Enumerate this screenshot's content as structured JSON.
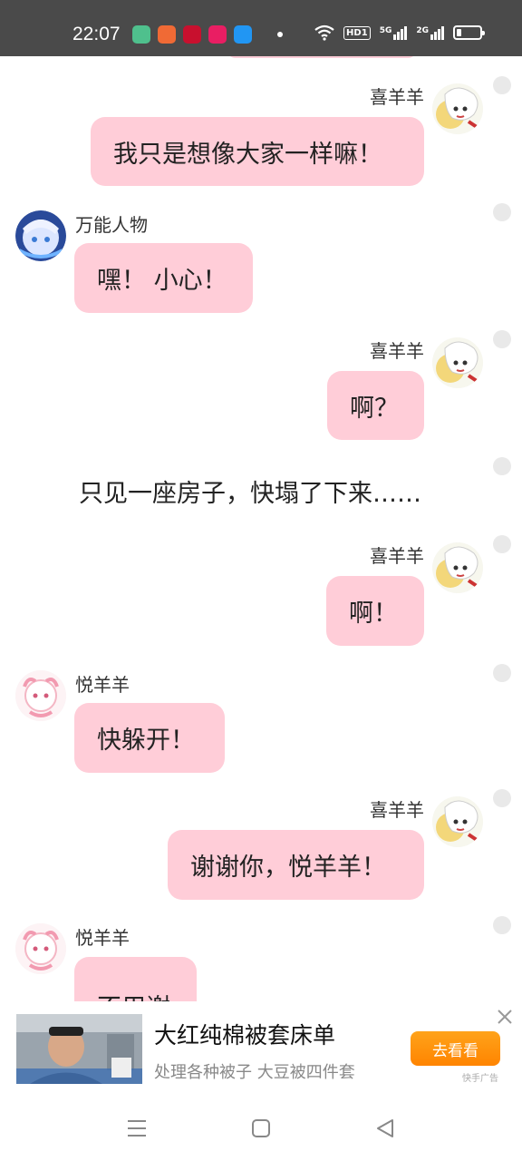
{
  "status_bar": {
    "time": "22:07",
    "app_icon_colors": [
      "#4fc08d",
      "#f06a35",
      "#c8102e",
      "#e91e63",
      "#2196f3"
    ],
    "network_labels": [
      "HD1",
      "5G",
      "2G"
    ],
    "battery_level": 0.2
  },
  "chat": {
    "messages": [
      {
        "type": "message",
        "side": "right",
        "sender": "喜羊羊",
        "text": "我只是想像大家一样嘛！",
        "avatar": "xiyangyang-avatar"
      },
      {
        "type": "message",
        "side": "left",
        "sender": "万能人物",
        "text": "嘿！ 小心！",
        "avatar": "wanneng-avatar"
      },
      {
        "type": "message",
        "side": "right",
        "sender": "喜羊羊",
        "text": "啊？",
        "avatar": "xiyangyang-avatar"
      },
      {
        "type": "narration",
        "text": "只见一座房子，快塌了下来……"
      },
      {
        "type": "message",
        "side": "right",
        "sender": "喜羊羊",
        "text": "啊！",
        "avatar": "xiyangyang-avatar"
      },
      {
        "type": "message",
        "side": "left",
        "sender": "悦羊羊",
        "text": "快躲开！",
        "avatar": "yueyangyang-avatar"
      },
      {
        "type": "message",
        "side": "right",
        "sender": "喜羊羊",
        "text": "谢谢你，悦羊羊！",
        "avatar": "xiyangyang-avatar"
      },
      {
        "type": "message",
        "side": "left",
        "sender": "悦羊羊",
        "text": "不用谢",
        "avatar": "yueyangyang-avatar"
      }
    ],
    "bubble_color": "#ffcdd8"
  },
  "ad": {
    "title": "大红纯棉被套床单",
    "subtitle": "处理各种被子 大豆被四件套",
    "button_label": "去看看",
    "tag": "快手广告",
    "button_color": "#ff8c00"
  },
  "navbar": {
    "icons": [
      "menu-icon",
      "home-icon",
      "back-icon"
    ]
  }
}
